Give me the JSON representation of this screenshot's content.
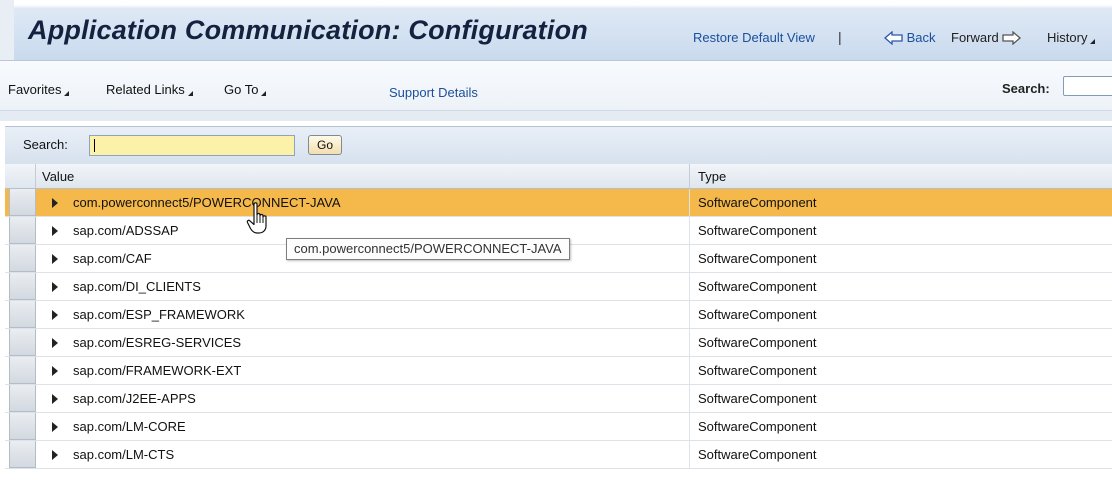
{
  "header": {
    "title": "Application Communication: Configuration",
    "restore_default_view": "Restore Default View",
    "separator": "|",
    "back": "Back",
    "forward": "Forward",
    "history": "History"
  },
  "menubar": {
    "favorites": "Favorites",
    "related_links": "Related Links",
    "go_to": "Go To",
    "support_details": "Support Details",
    "search_label": "Search:",
    "search_value": ""
  },
  "table": {
    "search_label": "Search:",
    "search_value": "",
    "go_label": "Go",
    "columns": [
      "Value",
      "Type"
    ],
    "rows": [
      {
        "value": "com.powerconnect5/POWERCONNECT-JAVA",
        "type": "SoftwareComponent",
        "selected": true
      },
      {
        "value": "sap.com/ADSSAP",
        "type": "SoftwareComponent"
      },
      {
        "value": "sap.com/CAF",
        "type": "SoftwareComponent"
      },
      {
        "value": "sap.com/DI_CLIENTS",
        "type": "SoftwareComponent"
      },
      {
        "value": "sap.com/ESP_FRAMEWORK",
        "type": "SoftwareComponent"
      },
      {
        "value": "sap.com/ESREG-SERVICES",
        "type": "SoftwareComponent"
      },
      {
        "value": "sap.com/FRAMEWORK-EXT",
        "type": "SoftwareComponent"
      },
      {
        "value": "sap.com/J2EE-APPS",
        "type": "SoftwareComponent"
      },
      {
        "value": "sap.com/LM-CORE",
        "type": "SoftwareComponent"
      },
      {
        "value": "sap.com/LM-CTS",
        "type": "SoftwareComponent"
      }
    ]
  },
  "tooltip": {
    "text": "com.powerconnect5/POWERCONNECT-JAVA"
  },
  "colors": {
    "selected_row": "#f5b84a",
    "link": "#1a4f9c",
    "title": "#14213f",
    "search_field": "#fbf1a8"
  },
  "icons": {
    "back": "back-arrow-icon",
    "forward": "forward-arrow-icon",
    "cursor": "hand-pointer-icon",
    "expander": "expand-triangle-icon"
  }
}
